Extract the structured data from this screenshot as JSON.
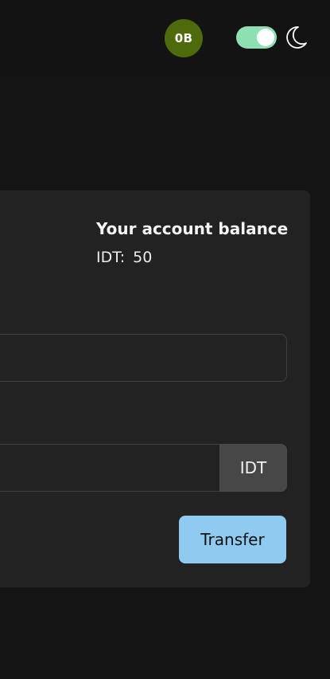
{
  "header": {
    "avatar_initials": "0B",
    "avatar_color": "#4f6a0b",
    "theme_toggle": {
      "state": "on",
      "track_color": "#8ee0b3"
    },
    "theme_icon": "moon-icon"
  },
  "balance": {
    "title": "Your account balance",
    "currency": "IDT:",
    "amount": "50"
  },
  "transfer_form": {
    "recipient_value": "",
    "amount_value": "",
    "amount_unit": "IDT",
    "submit_label": "Transfer",
    "submit_color": "#8fcaf0"
  }
}
